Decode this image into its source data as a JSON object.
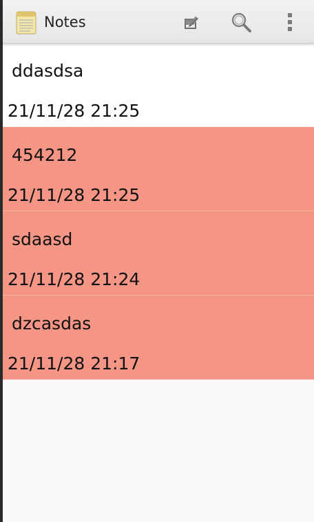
{
  "app": {
    "title": "Notes"
  },
  "toolbar": {
    "compose_icon": "compose-note-icon",
    "search_icon": "search-icon",
    "overflow_icon": "overflow-menu-icon"
  },
  "notes": [
    {
      "title": "ddasdsa",
      "date": "21/11/28 21:25",
      "selected": false
    },
    {
      "title": "454212",
      "date": "21/11/28 21:25",
      "selected": true
    },
    {
      "title": "sdaasd",
      "date": "21/11/28 21:24",
      "selected": true
    },
    {
      "title": "dzcasdas",
      "date": "21/11/28 21:17",
      "selected": true
    }
  ],
  "colors": {
    "selected_row": "#f49585",
    "plain_row": "#ffffff",
    "background": "#fafafa"
  }
}
